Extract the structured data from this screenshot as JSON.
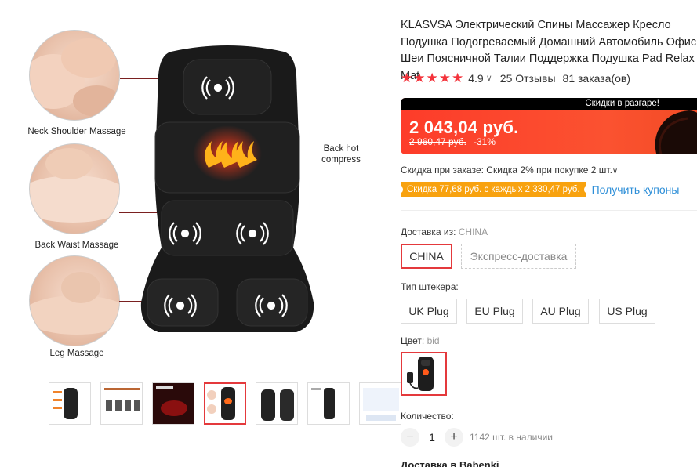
{
  "gallery": {
    "labels": {
      "neck": "Neck Shoulder Massage",
      "back_waist": "Back Waist Massage",
      "leg": "Leg Massage",
      "hot_line1": "Back hot",
      "hot_line2": "compress"
    },
    "thumbnail_count": 7,
    "active_thumbnail": 4
  },
  "product": {
    "title": "KLASVSA Электрический Спины Массажер Кресло Подушка Подогреваемый Домашний Автомобиль Офис Шеи Поясничной Талии Поддержка Подушка Pad Relax Mat",
    "rating": "4.9",
    "rating_stars": 5,
    "reviews": "25 Отзывы",
    "orders": "81 заказа(ов)"
  },
  "price": {
    "promo_label": "Скидки в разгаре!",
    "current": "2 043,04 руб.",
    "old": "2 960,47 руб.",
    "discount": "-31%"
  },
  "discounts": {
    "order_discount": "Скидка при заказе: Скидка 2% при покупке 2 шт.",
    "coupon_tag": "Скидка 77,68 руб. с каждых 2 330,47 руб.",
    "coupon_link": "Получить купоны"
  },
  "shipping": {
    "label": "Доставка из:",
    "selected": "CHINA",
    "options": [
      "CHINA",
      "Экспресс-доставка"
    ]
  },
  "plug": {
    "label": "Тип штекера:",
    "options": [
      "UK Plug",
      "EU Plug",
      "AU Plug",
      "US Plug"
    ]
  },
  "color": {
    "label": "Цвет:",
    "selected": "bid"
  },
  "quantity": {
    "label": "Количество:",
    "value": "1",
    "minus": "−",
    "plus": "+",
    "stock": "1142 шт. в наличии"
  },
  "delivery": {
    "heading": "Доставка в Babenki"
  },
  "colors": {
    "accent": "#e4393c",
    "price_bg": "#fd3c2a",
    "coupon_bg": "#f8a20f",
    "link": "#2e8fd8",
    "star": "#f4333b"
  }
}
